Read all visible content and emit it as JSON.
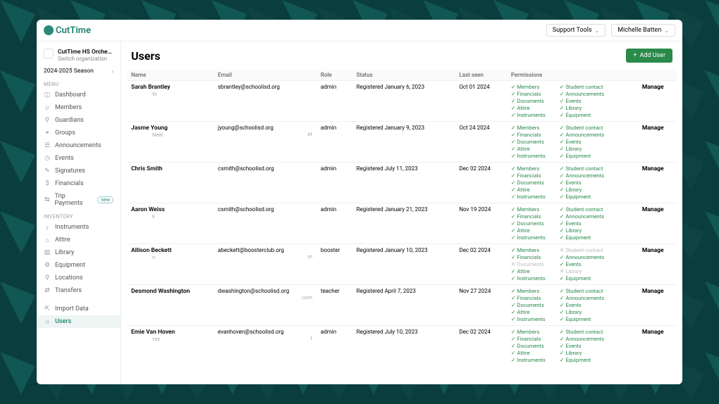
{
  "topbar": {
    "brand": "CutTime",
    "support": "Support Tools",
    "user": "Michelle Batten"
  },
  "org": {
    "name": "CutTime HS Orchestra...",
    "sub": "Switch organization",
    "season": "2024-2025 Season"
  },
  "menu": {
    "header1": "MENU",
    "items1": [
      {
        "icon": "◫",
        "label": "Dashboard"
      },
      {
        "icon": "☺",
        "label": "Members"
      },
      {
        "icon": "⚲",
        "label": "Guardians"
      },
      {
        "icon": "⚭",
        "label": "Groups"
      },
      {
        "icon": "☰",
        "label": "Announcements"
      },
      {
        "icon": "◷",
        "label": "Events"
      },
      {
        "icon": "✎",
        "label": "Signatures"
      },
      {
        "icon": "$",
        "label": "Financials"
      },
      {
        "icon": "⇆",
        "label": "Trip Payments",
        "badge": "new"
      }
    ],
    "header2": "INVENTORY",
    "items2": [
      {
        "icon": "♪",
        "label": "Instruments"
      },
      {
        "icon": "⌂",
        "label": "Attire"
      },
      {
        "icon": "▤",
        "label": "Library"
      },
      {
        "icon": "⚙",
        "label": "Equipment"
      },
      {
        "icon": "⚲",
        "label": "Locations"
      },
      {
        "icon": "⇄",
        "label": "Transfers"
      }
    ],
    "items3": [
      {
        "icon": "⇱",
        "label": "Import Data"
      },
      {
        "icon": "☺",
        "label": "Users",
        "active": true
      }
    ]
  },
  "page": {
    "title": "Users",
    "addBtn": "Add User"
  },
  "cols": {
    "name": "Name",
    "email": "Email",
    "role": "Role",
    "status": "Status",
    "lastSeen": "Last seen",
    "permissions": "Permissions",
    "manage": "Manage"
  },
  "permLabels": {
    "members": "Members",
    "financials": "Financials",
    "documents": "Documents",
    "attire": "Attire",
    "instruments": "Instruments",
    "studentContact": "Student contact",
    "announcements": "Announcements",
    "events": "Events",
    "library": "Library",
    "equipment": "Equipment"
  },
  "users": [
    {
      "name": "Sarah Brantley",
      "nameSuffix": "th",
      "email": "sbrantley@schoolisd.org",
      "role": "admin",
      "status": "Registered January 6, 2023",
      "lastSeen": "Oct 01 2024",
      "perms": {
        "members": true,
        "financials": true,
        "documents": true,
        "attire": true,
        "instruments": true,
        "studentContact": true,
        "announcements": true,
        "events": true,
        "library": true,
        "equipment": true
      }
    },
    {
      "name": "Jasme Young",
      "nameSuffix": "Neill",
      "email": "jyoung@schoolisd.org",
      "emailSuffix": "et",
      "role": "admin",
      "status": "Registered January 9, 2023",
      "lastSeen": "Oct 24 2024",
      "perms": {
        "members": true,
        "financials": true,
        "documents": true,
        "attire": true,
        "instruments": true,
        "studentContact": true,
        "announcements": true,
        "events": true,
        "library": true,
        "equipment": true
      }
    },
    {
      "name": "Chris Smith",
      "email": "csmith@schoolisd.org",
      "role": "admin",
      "status": "Registered July 11, 2023",
      "lastSeen": "Dec 02 2024",
      "perms": {
        "members": true,
        "financials": true,
        "documents": true,
        "attire": true,
        "instruments": true,
        "studentContact": true,
        "announcements": true,
        "events": true,
        "library": true,
        "equipment": true
      }
    },
    {
      "name": "Aaron Weiss",
      "nameSuffix": "k",
      "email": "csmith@schoolisd.org",
      "role": "admin",
      "status": "Registered January 21, 2023",
      "lastSeen": "Nov 19 2024",
      "perms": {
        "members": true,
        "financials": true,
        "documents": true,
        "attire": true,
        "instruments": true,
        "studentContact": true,
        "announcements": true,
        "events": true,
        "library": true,
        "equipment": true
      }
    },
    {
      "name": "Allison Beckett",
      "nameSuffix": "n",
      "email": "abeckett@boosterclub.org",
      "emailSuffix": "m",
      "role": "booster",
      "status": "Registered January 10, 2023",
      "lastSeen": "Dec 02 2024",
      "perms": {
        "members": true,
        "financials": true,
        "documents": false,
        "attire": true,
        "instruments": true,
        "studentContact": false,
        "announcements": true,
        "events": true,
        "library": false,
        "equipment": true
      }
    },
    {
      "name": "Desmond Washington",
      "email": "dwashington@schoolisd.org",
      "emailSuffix": "com",
      "role": "teacher",
      "status": "Registered April 7, 2023",
      "lastSeen": "Nov 27 2024",
      "perms": {
        "members": true,
        "financials": true,
        "documents": true,
        "attire": true,
        "instruments": true,
        "studentContact": true,
        "announcements": true,
        "events": true,
        "library": true,
        "equipment": true
      }
    },
    {
      "name": "Emie Van Hoven",
      "nameSuffix": "vez",
      "email": "evanhoven@schoolisd.org",
      "emailSuffix": "t",
      "role": "admin",
      "status": "Registered July 10, 2023",
      "lastSeen": "Dec 02 2024",
      "perms": {
        "members": true,
        "financials": true,
        "documents": true,
        "attire": true,
        "instruments": true,
        "studentContact": true,
        "announcements": true,
        "events": true,
        "library": true,
        "equipment": true
      }
    }
  ]
}
